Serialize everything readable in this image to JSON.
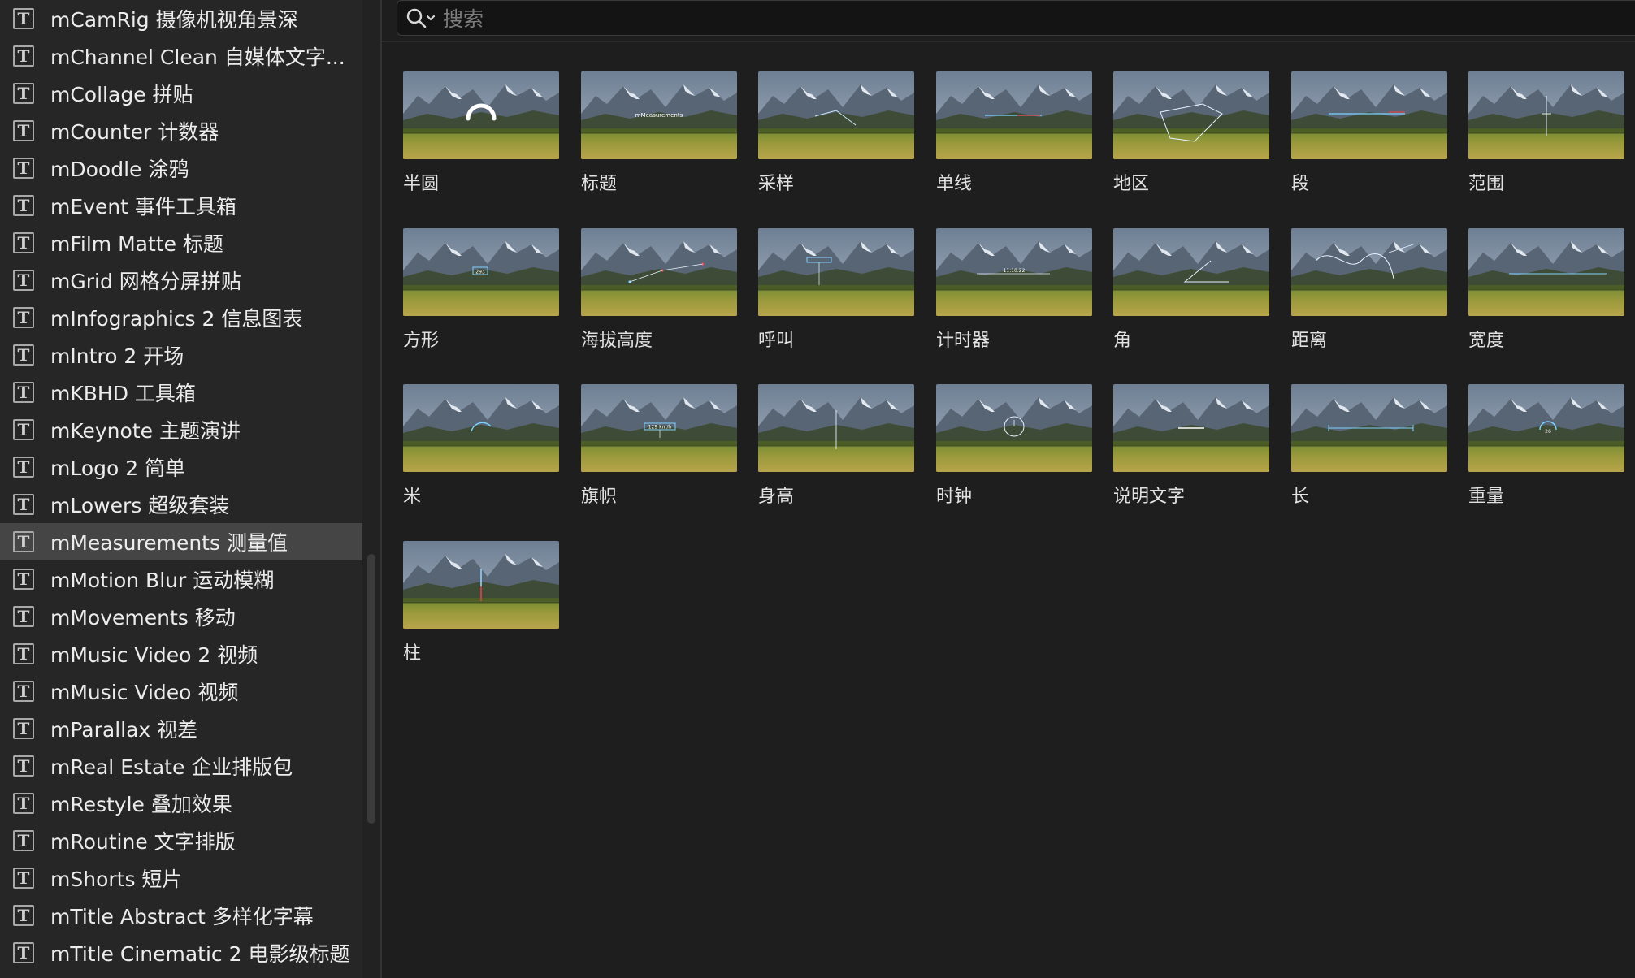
{
  "search": {
    "placeholder": "搜索",
    "value": ""
  },
  "sidebar": {
    "selected_index": 14,
    "items": [
      {
        "label": "mCamRig 摄像机视角景深"
      },
      {
        "label": "mChannel Clean 自媒体文字..."
      },
      {
        "label": "mCollage 拼贴"
      },
      {
        "label": "mCounter 计数器"
      },
      {
        "label": "mDoodle 涂鸦"
      },
      {
        "label": "mEvent 事件工具箱"
      },
      {
        "label": "mFilm Matte 标题"
      },
      {
        "label": "mGrid 网格分屏拼贴"
      },
      {
        "label": "mInfographics 2 信息图表"
      },
      {
        "label": "mIntro 2 开场"
      },
      {
        "label": "mKBHD 工具箱"
      },
      {
        "label": "mKeynote 主题演讲"
      },
      {
        "label": "mLogo 2 简单"
      },
      {
        "label": "mLowers 超级套装"
      },
      {
        "label": "mMeasurements 测量值"
      },
      {
        "label": "mMotion Blur 运动模糊"
      },
      {
        "label": "mMovements 移动"
      },
      {
        "label": "mMusic Video 2 视频"
      },
      {
        "label": "mMusic Video 视频"
      },
      {
        "label": "mParallax 视差"
      },
      {
        "label": "mReal Estate 企业排版包"
      },
      {
        "label": "mRestyle 叠加效果"
      },
      {
        "label": "mRoutine 文字排版"
      },
      {
        "label": "mShorts 短片"
      },
      {
        "label": "mTitle Abstract 多样化字幕"
      },
      {
        "label": "mTitle Cinematic 2 电影级标题"
      }
    ]
  },
  "browser": {
    "tiles": [
      {
        "label": "半圆",
        "overlay": "semicircle"
      },
      {
        "label": "标题",
        "overlay": "title",
        "overlay_text": "mMeasurements"
      },
      {
        "label": "采样",
        "overlay": "sample"
      },
      {
        "label": "单线",
        "overlay": "line"
      },
      {
        "label": "地区",
        "overlay": "region"
      },
      {
        "label": "段",
        "overlay": "segment"
      },
      {
        "label": "范围",
        "overlay": "range"
      },
      {
        "label": "方形",
        "overlay": "square",
        "overlay_text": "293"
      },
      {
        "label": "海拔高度",
        "overlay": "altitude"
      },
      {
        "label": "呼叫",
        "overlay": "callout"
      },
      {
        "label": "计时器",
        "overlay": "timer",
        "overlay_text": "11:10.22"
      },
      {
        "label": "角",
        "overlay": "angle"
      },
      {
        "label": "距离",
        "overlay": "distance"
      },
      {
        "label": "宽度",
        "overlay": "width"
      },
      {
        "label": "米",
        "overlay": "meter"
      },
      {
        "label": "旗帜",
        "overlay": "flag",
        "overlay_text": "129 km/h"
      },
      {
        "label": "身高",
        "overlay": "height"
      },
      {
        "label": "时钟",
        "overlay": "clock"
      },
      {
        "label": "说明文字",
        "overlay": "caption"
      },
      {
        "label": "长",
        "overlay": "length"
      },
      {
        "label": "重量",
        "overlay": "weight",
        "overlay_text": "26"
      },
      {
        "label": "柱",
        "overlay": "pillar"
      }
    ]
  },
  "colors": {
    "background": "#1e1e1e",
    "sidebar": "#262626",
    "selected_row": "#454545",
    "text": "#ececec",
    "overlay_accent": "#7fd3ff",
    "overlay_red": "#e0444f"
  }
}
